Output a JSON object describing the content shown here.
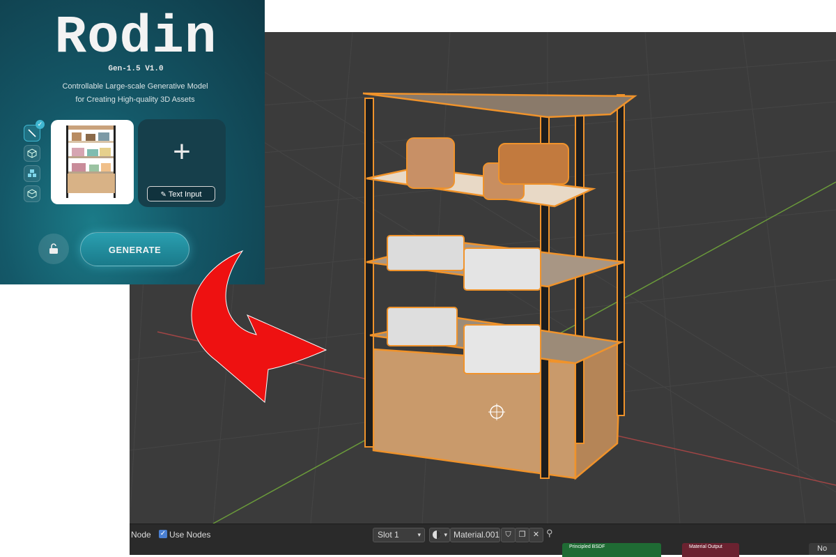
{
  "rodin_panel": {
    "title": "Rodin",
    "version": "Gen-1.5 V1.0",
    "tagline_line1": "Controllable Large-scale Generative Model",
    "tagline_line2": "for Creating High-quality 3D Assets",
    "text_input_label": "Text Input",
    "plus_glyph": "+",
    "generate_label": "GENERATE",
    "tool_icons": [
      "brush-icon",
      "cube-icon",
      "stacked-cubes-icon",
      "cube-outline-icon"
    ],
    "accent_color": "#2a9fb0"
  },
  "node_header": {
    "node_label": "Node",
    "use_nodes_label": "Use Nodes",
    "use_nodes_checked": true,
    "slot_value": "Slot 1",
    "material_name": "Material.001",
    "node_card_1": "Principled BSDF",
    "node_card_2": "Material Output",
    "right_cut_label": "No"
  },
  "viewport": {
    "background_color": "#3b3b3b",
    "selection_outline_color": "#f0932b",
    "x_axis_color": "#a04545",
    "y_axis_color": "#6a9a3a"
  }
}
